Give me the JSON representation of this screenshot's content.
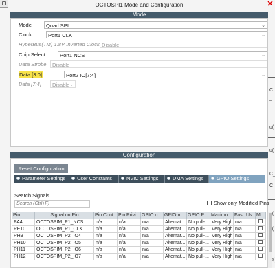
{
  "window": {
    "title": "OCTOSPI1 Mode and Configuration"
  },
  "mode": {
    "header": "Mode",
    "fields": [
      {
        "label": "Mode",
        "value": "Quad SPI",
        "disabled": false,
        "highlight": false
      },
      {
        "label": "Clock",
        "value": "Port1 CLK",
        "disabled": false,
        "highlight": false
      },
      {
        "label": "HyperBus(TM) 1.8V Inverted Clock",
        "value": "Disable",
        "disabled": true,
        "highlight": false
      },
      {
        "label": "Chip Select",
        "value": "Port1 NCS",
        "disabled": false,
        "highlight": false
      },
      {
        "label": "Data Strobe",
        "value": "Disable",
        "disabled": true,
        "highlight": false
      },
      {
        "label": "Data [3:0]",
        "value": "Port2 IO[7:4]",
        "disabled": false,
        "highlight": true
      },
      {
        "label": "Data [7:4]",
        "value": "Disable",
        "disabled": true,
        "highlight": false
      }
    ]
  },
  "config": {
    "header": "Configuration",
    "reset_label": "Reset Configuration",
    "tabs": [
      "Parameter Settings",
      "User Constants",
      "NVIC Settings",
      "DMA Settings",
      "GPIO Settings"
    ],
    "active_tab": "GPIO Settings",
    "search_label": "Search Signals",
    "search_placeholder": "Search (Ctrl+F)",
    "show_modified_label": "Show only Modified Pins",
    "columns": [
      "Pin ...",
      "Signal on Pin",
      "Pin Cont...",
      "Pin Privi...",
      "GPIO o...",
      "GPIO m...",
      "GPIO P...",
      "Maximu...",
      "Fas...",
      "Us...",
      "M..."
    ],
    "rows": [
      [
        "PA4",
        "OCTOSPIM_P1_NCS",
        "n/a",
        "n/a",
        "n/a",
        "Altemat...",
        "No pull-...",
        "Very High",
        "n/a",
        "",
        ""
      ],
      [
        "PE10",
        "OCTOSPIM_P1_CLK",
        "n/a",
        "n/a",
        "n/a",
        "Altemat...",
        "No pull-...",
        "Very High",
        "n/a",
        "",
        ""
      ],
      [
        "PH9",
        "OCTOSPIM_P2_IO4",
        "n/a",
        "n/a",
        "n/a",
        "Altemat...",
        "No pull-...",
        "Very High",
        "n/a",
        "",
        ""
      ],
      [
        "PH10",
        "OCTOSPIM_P2_IO5",
        "n/a",
        "n/a",
        "n/a",
        "Altemat...",
        "No pull-...",
        "Very High",
        "n/a",
        "",
        ""
      ],
      [
        "PH11",
        "OCTOSPIM_P2_IO6",
        "n/a",
        "n/a",
        "n/a",
        "Altemat...",
        "No pull-...",
        "Very High",
        "n/a",
        "",
        ""
      ],
      [
        "PH12",
        "OCTOSPIM_P2_IO7",
        "n/a",
        "n/a",
        "n/a",
        "Altemat...",
        "No pull-...",
        "Very High",
        "n/a",
        "",
        ""
      ]
    ]
  },
  "edge_text": [
    "C",
    "_",
    "u(",
    "u(",
    "C_",
    "C_",
    "u(",
    "u(",
    "R("
  ]
}
